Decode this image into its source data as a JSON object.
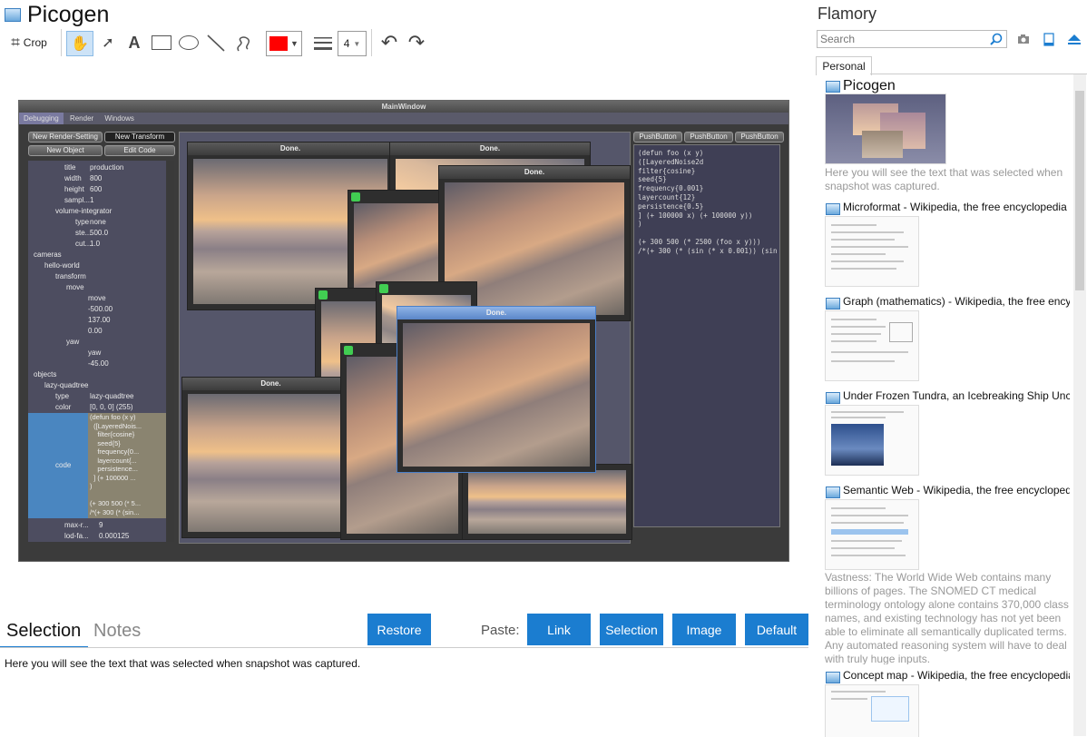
{
  "header": {
    "title": "Picogen"
  },
  "toolbar": {
    "crop_label": "Crop",
    "line_width": "4",
    "color": "#ff0000"
  },
  "inner": {
    "window_title": "MainWindow",
    "menu": [
      "Debugging",
      "Render",
      "Windows"
    ],
    "left_buttons": [
      "New Render-Setting",
      "New Transform",
      "New Object",
      "Edit Code"
    ],
    "push_buttons": [
      "PushButton",
      "PushButton",
      "PushButton"
    ],
    "tree": [
      {
        "indent": 40,
        "k": "title",
        "v": "production"
      },
      {
        "indent": 40,
        "k": "width",
        "v": "800"
      },
      {
        "indent": 40,
        "k": "height",
        "v": "600"
      },
      {
        "indent": 40,
        "k": "sampl...",
        "v": "1"
      },
      {
        "indent": 30,
        "k": "volume-integrator",
        "v": ""
      },
      {
        "indent": 52,
        "k": "type",
        "v": "none"
      },
      {
        "indent": 52,
        "k": "ste...",
        "v": "500.0"
      },
      {
        "indent": 52,
        "k": "cut...",
        "v": "1.0"
      },
      {
        "indent": 6,
        "k": "cameras",
        "v": ""
      },
      {
        "indent": 18,
        "k": "hello-world",
        "v": ""
      },
      {
        "indent": 30,
        "k": "transform",
        "v": ""
      },
      {
        "indent": 42,
        "k": "move",
        "v": ""
      },
      {
        "indent": 66,
        "k": "move",
        "v": ""
      },
      {
        "indent": 66,
        "k": "-500.00",
        "v": ""
      },
      {
        "indent": 66,
        "k": "137.00",
        "v": ""
      },
      {
        "indent": 66,
        "k": "0.00",
        "v": ""
      },
      {
        "indent": 42,
        "k": "yaw",
        "v": ""
      },
      {
        "indent": 66,
        "k": "yaw",
        "v": ""
      },
      {
        "indent": 66,
        "k": "-45.00",
        "v": ""
      },
      {
        "indent": 6,
        "k": "objects",
        "v": ""
      },
      {
        "indent": 18,
        "k": "lazy-quadtree",
        "v": ""
      },
      {
        "indent": 30,
        "k": "type",
        "v": "lazy-quadtree"
      },
      {
        "indent": 30,
        "k": "color",
        "v": "[0, 0, 0] (255)"
      }
    ],
    "tree_code_label": "code",
    "tree_code_lines": [
      "(defun foo (x y)",
      "  ([LayeredNois...",
      "    filter{cosine}",
      "    seed{5}",
      "    frequency{0...",
      "    layercount{...",
      "    persistence...",
      "  ] (+ 100000 ...",
      ")",
      "",
      "(+ 300 500 (* 5...",
      "/*(+ 300 (* (sin..."
    ],
    "tree_tail": [
      {
        "k": "max-r...",
        "v": "9"
      },
      {
        "k": "lod-fa...",
        "v": "0.000125"
      }
    ],
    "done_title": "Done.",
    "code_lines": [
      "(defun foo (x y)",
      "  ([LayeredNoise2d",
      "    filter{cosine}",
      "    seed{5}",
      "    frequency{0.001}",
      "    layercount{12}",
      "    persistence{0.5}",
      "  ] (+ 100000 x) (+ 100000 y))",
      ")",
      "",
      "(+ 300 500 (* 2500  (foo x y)))",
      "/*(+ 300 (* (sin (* x 0.001)) (sin"
    ]
  },
  "bottom": {
    "tabs": [
      "Selection",
      "Notes"
    ],
    "restore_label": "Restore",
    "paste_label": "Paste:",
    "paste_buttons": [
      "Link",
      "Selection",
      "Image",
      "Default"
    ],
    "selection_text": "Here you will see the text that was selected when snapshot was captured."
  },
  "sidebar": {
    "title": "Flamory",
    "search_placeholder": "Search",
    "tab": "Personal",
    "entries": [
      {
        "title": "Picogen",
        "desc": "Here you will see the text that was selected when snapshot was captured."
      },
      {
        "title": "Microformat - Wikipedia, the free encyclopedia",
        "desc": ""
      },
      {
        "title": "Graph (mathematics) - Wikipedia, the free encyclopedia",
        "desc": ""
      },
      {
        "title": "Under Frozen Tundra, an Icebreaking Ship Uncovers",
        "desc": ""
      },
      {
        "title": "Semantic Web - Wikipedia, the free encyclopedia",
        "desc": "Vastness: The World Wide Web contains many billions of pages. The SNOMED CT medical terminology ontology alone contains 370,000 class names, and existing technology has not yet been able to eliminate all semantically duplicated terms. Any automated reasoning system will have to deal with truly huge inputs."
      },
      {
        "title": "Concept map - Wikipedia, the free encyclopedia",
        "desc": ""
      }
    ]
  }
}
